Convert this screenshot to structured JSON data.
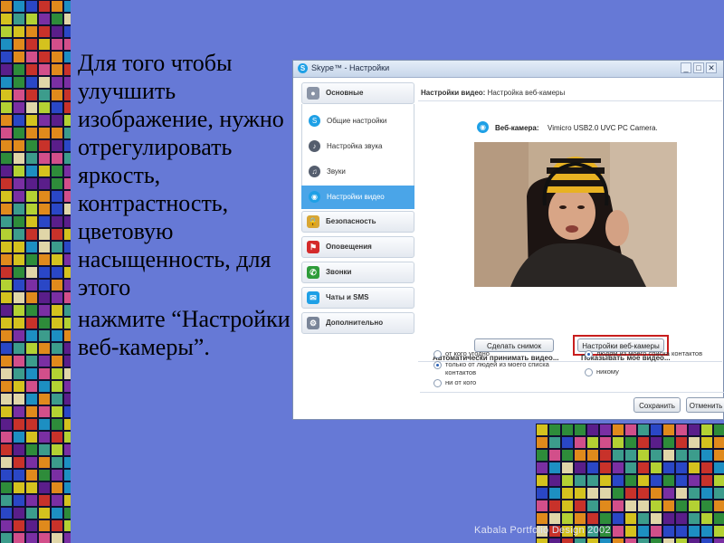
{
  "slide": {
    "paragraph1": "Для того чтобы улучшить изображение, нужно отрегулировать яркость, контрастность, цветовую насыщенность, для этого",
    "paragraph2": "нажмите “Настройки веб-камеры”.",
    "footer": "Kabala Portfolio Design 2002"
  },
  "window": {
    "title": "Skype™ - Настройки",
    "controls": [
      "_",
      "□",
      "✕"
    ]
  },
  "sidebar": {
    "groups": [
      {
        "label": "Основные",
        "icon": "person-icon",
        "color": "#8a94a6"
      },
      {
        "label": "Безопасность",
        "icon": "lock-icon",
        "color": "#d8a634"
      },
      {
        "label": "Оповещения",
        "icon": "flag-icon",
        "color": "#d42a2a"
      },
      {
        "label": "Звонки",
        "icon": "phone-icon",
        "color": "#2e9c3a"
      },
      {
        "label": "Чаты и SMS",
        "icon": "chat-icon",
        "color": "#1ea0e6"
      },
      {
        "label": "Дополнительно",
        "icon": "gear-icon",
        "color": "#7a8598"
      }
    ],
    "items": [
      {
        "label": "Общие настройки",
        "icon": "skype-icon",
        "color": "#1ea0e6"
      },
      {
        "label": "Настройка звука",
        "icon": "microphone-icon",
        "color": "#555e6e"
      },
      {
        "label": "Звуки",
        "icon": "speaker-icon",
        "color": "#555e6e"
      },
      {
        "label": "Настройки видео",
        "icon": "webcam-icon",
        "color": "#1ea0e6"
      }
    ],
    "active_item": "Настройки видео"
  },
  "content": {
    "header_bold": "Настройки видео:",
    "header_rest": " Настройка веб-камеры",
    "webcam_label": "Веб-камера:",
    "webcam_name": "Vimicro USB2.0 UVC PC Camera.",
    "snapshot_button": "Сделать снимок",
    "webcam_settings_button": "Настройки веб-камеры",
    "accept_title": "Автоматически принимать видео...",
    "accept_options": [
      {
        "label": "от кого угодно",
        "selected": false
      },
      {
        "label": "только от людей из моего списка контактов",
        "selected": true
      },
      {
        "label": "ни от кого",
        "selected": false
      }
    ],
    "show_title": "Показывать мое видео...",
    "show_options": [
      {
        "label": "людям из моего списка контактов",
        "selected": true
      },
      {
        "label": "никому",
        "selected": false
      }
    ],
    "save_button": "Сохранить",
    "cancel_button": "Отменить"
  },
  "colors": {
    "background": "#6679d6",
    "highlight": "#c81e1e",
    "active_item": "#4aa5e8"
  }
}
